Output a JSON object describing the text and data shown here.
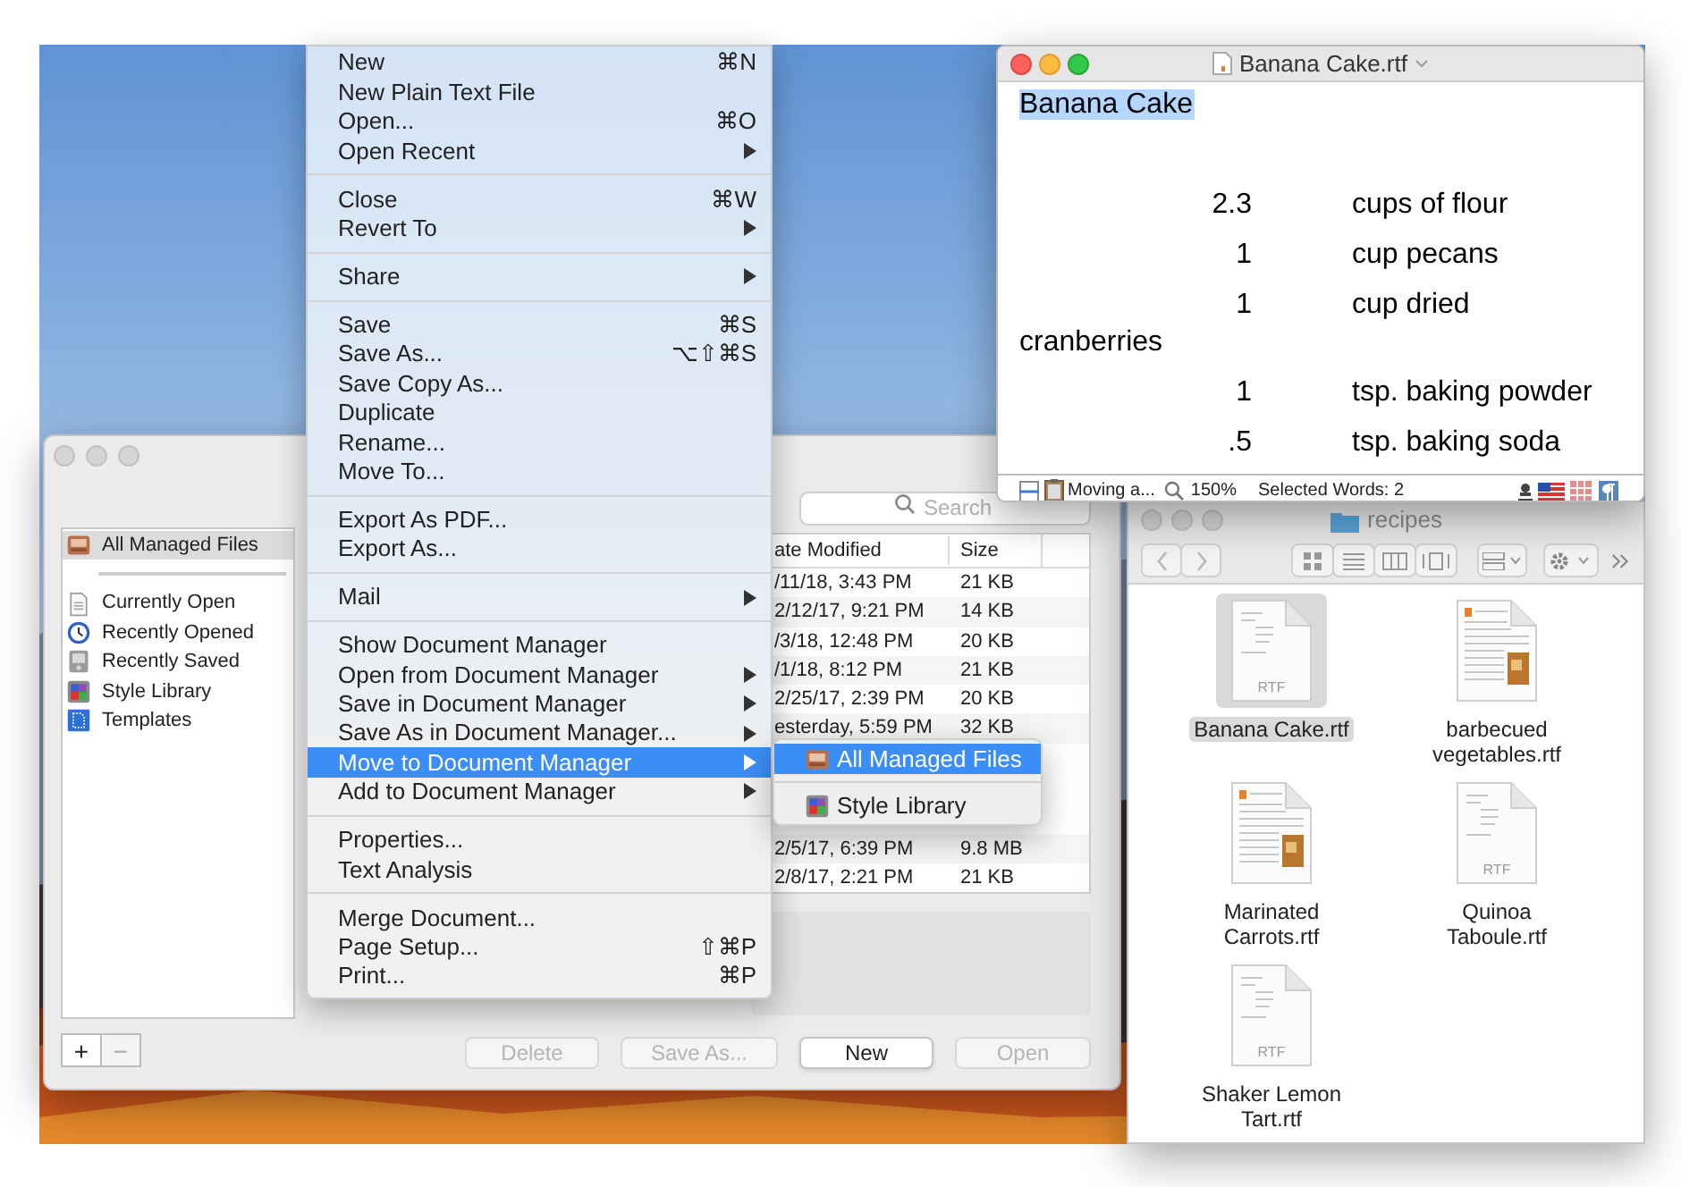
{
  "document_manager": {
    "sidebar": {
      "groups": [
        [
          {
            "label": "All Managed Files",
            "kind": "drawer",
            "selected": true
          }
        ],
        [
          {
            "label": "Currently Open",
            "kind": "document",
            "selected": false
          },
          {
            "label": "Recently Opened",
            "kind": "clock",
            "selected": false
          },
          {
            "label": "Recently Saved",
            "kind": "disk",
            "selected": false
          },
          {
            "label": "Style Library",
            "kind": "palette",
            "selected": false
          },
          {
            "label": "Templates",
            "kind": "blueprint",
            "selected": false
          }
        ]
      ]
    },
    "list_buttons": [
      {
        "label": "+",
        "disabled": false
      },
      {
        "label": "−",
        "disabled": true
      }
    ],
    "search": {
      "placeholder": "Search"
    },
    "table": {
      "columns": [
        "ate Modified",
        "Size"
      ],
      "rows": [
        {
          "date": "/11/18, 3:43 PM",
          "size": "21 KB"
        },
        {
          "date": "2/12/17, 9:21 PM",
          "size": "14 KB"
        },
        {
          "date": "/3/18, 12:48 PM",
          "size": "20 KB"
        },
        {
          "date": "/1/18, 8:12 PM",
          "size": "21 KB"
        },
        {
          "date": "2/25/17, 2:39 PM",
          "size": "20 KB"
        },
        {
          "date": "esterday, 5:59 PM",
          "size": "32 KB"
        }
      ],
      "rows_below_menu": [
        {
          "date": "2/5/17, 6:39 PM",
          "size": "9.8 MB"
        },
        {
          "date": "2/8/17, 2:21 PM",
          "size": "21 KB"
        }
      ]
    },
    "buttons": [
      {
        "label": "Delete",
        "disabled": true
      },
      {
        "label": "Save As...",
        "disabled": true
      },
      {
        "label": "New",
        "disabled": false
      },
      {
        "label": "Open",
        "disabled": true
      }
    ]
  },
  "file_menu": {
    "groups": [
      [
        {
          "label": "New",
          "shortcut": "⌘N",
          "submenu": false,
          "selected": false
        },
        {
          "label": "New Plain Text File",
          "submenu": false,
          "selected": false
        },
        {
          "label": "Open...",
          "shortcut": "⌘O",
          "submenu": false,
          "selected": false
        },
        {
          "label": "Open Recent",
          "submenu": true,
          "selected": false
        }
      ],
      [
        {
          "label": "Close",
          "shortcut": "⌘W",
          "submenu": false,
          "selected": false
        },
        {
          "label": "Revert To",
          "submenu": true,
          "selected": false
        }
      ],
      [
        {
          "label": "Share",
          "submenu": true,
          "selected": false
        }
      ],
      [
        {
          "label": "Save",
          "shortcut": "⌘S",
          "submenu": false,
          "selected": false
        },
        {
          "label": "Save As...",
          "shortcut": "⌥⇧⌘S",
          "submenu": false,
          "selected": false
        },
        {
          "label": "Save Copy As...",
          "submenu": false,
          "selected": false
        },
        {
          "label": "Duplicate",
          "submenu": false,
          "selected": false
        },
        {
          "label": "Rename...",
          "submenu": false,
          "selected": false
        },
        {
          "label": "Move To...",
          "submenu": false,
          "selected": false
        }
      ],
      [
        {
          "label": "Export As PDF...",
          "submenu": false,
          "selected": false
        },
        {
          "label": "Export As...",
          "submenu": false,
          "selected": false
        }
      ],
      [
        {
          "label": "Mail",
          "submenu": true,
          "selected": false
        }
      ],
      [
        {
          "label": "Show Document Manager",
          "submenu": false,
          "selected": false
        },
        {
          "label": "Open from Document Manager",
          "submenu": true,
          "selected": false
        },
        {
          "label": "Save in Document Manager",
          "submenu": true,
          "selected": false
        },
        {
          "label": "Save As in Document Manager...",
          "submenu": true,
          "selected": false
        },
        {
          "label": "Move to Document Manager",
          "submenu": true,
          "selected": true
        },
        {
          "label": "Add to Document Manager",
          "submenu": true,
          "selected": false
        }
      ],
      [
        {
          "label": "Properties...",
          "submenu": false,
          "selected": false
        },
        {
          "label": "Text Analysis",
          "submenu": false,
          "selected": false
        }
      ],
      [
        {
          "label": "Merge Document...",
          "submenu": false,
          "selected": false
        },
        {
          "label": "Page Setup...",
          "shortcut": "⇧⌘P",
          "submenu": false,
          "selected": false
        },
        {
          "label": "Print...",
          "shortcut": "⌘P",
          "submenu": false,
          "selected": false
        }
      ]
    ]
  },
  "submenu": {
    "groups": [
      [
        {
          "label": "All Managed Files",
          "kind": "drawer",
          "selected": true
        }
      ],
      [
        {
          "label": "Style Library",
          "kind": "palette",
          "selected": false
        }
      ]
    ]
  },
  "editor": {
    "title": "Banana Cake.rtf",
    "heading": "Banana Cake",
    "heading_selected": true,
    "lines": [
      {
        "quantity": "2.3",
        "item": "cups of flour"
      },
      {
        "quantity": "1",
        "item": "cup pecans"
      },
      {
        "quantity": "1",
        "item": "cup dried cranberries"
      },
      {
        "quantity": "1",
        "item": "tsp. baking powder"
      },
      {
        "quantity": ".5",
        "item": "tsp. baking soda"
      }
    ],
    "status": {
      "task": "Moving a...",
      "zoom": "150%",
      "selection": "Selected Words: 2"
    }
  },
  "finder": {
    "title": "recipes",
    "files": [
      {
        "name": "Banana Cake.rtf",
        "kind": "plain",
        "badge": "RTF",
        "selected": true
      },
      {
        "name": "barbecued vegetables.rtf",
        "kind": "illustrated",
        "selected": false
      },
      {
        "name": "Marinated Carrots.rtf",
        "kind": "illustrated",
        "selected": false
      },
      {
        "name": "Quinoa Taboule.rtf",
        "kind": "plain",
        "badge": "RTF",
        "selected": false
      },
      {
        "name": "Shaker Lemon Tart.rtf",
        "kind": "plain",
        "badge": "RTF",
        "selected": false
      }
    ]
  }
}
